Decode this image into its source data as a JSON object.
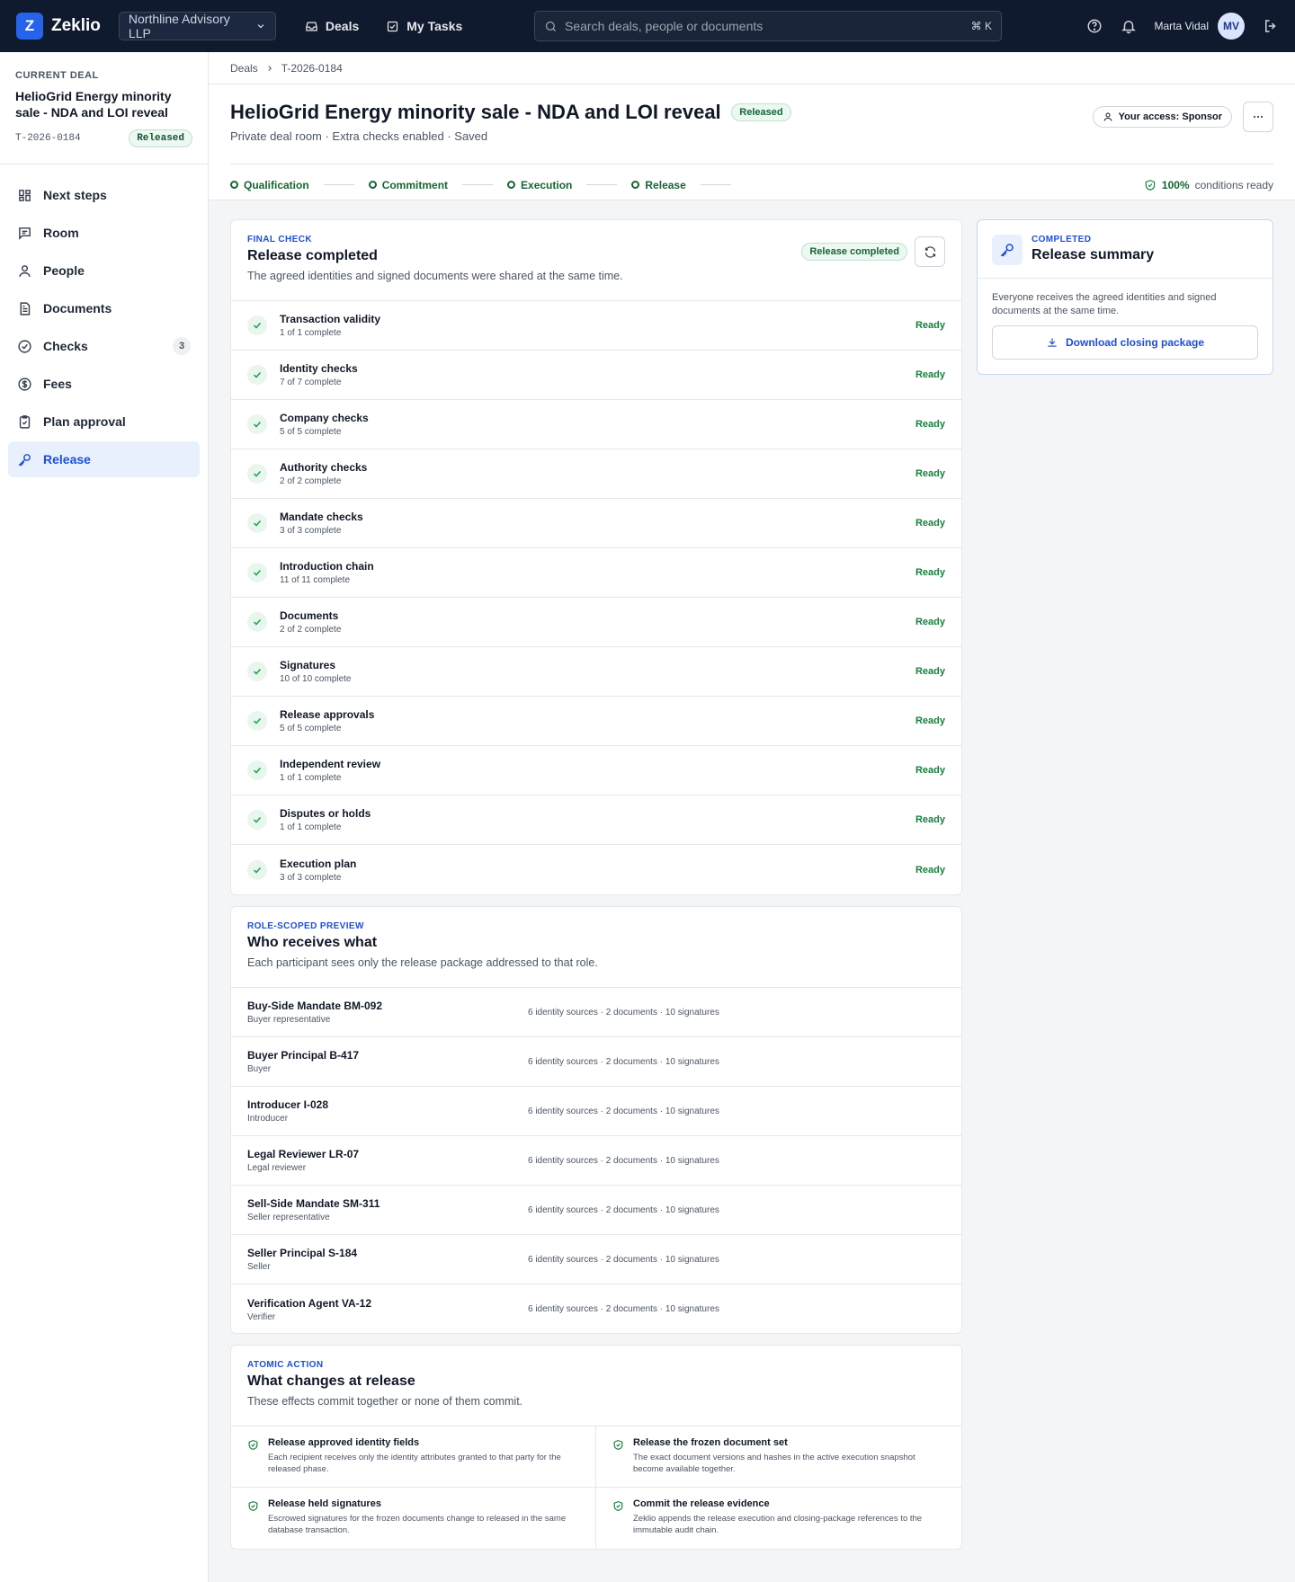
{
  "topbar": {
    "logo_letter": "Z",
    "app_name": "Zeklio",
    "org": "Northline Advisory LLP",
    "nav": [
      {
        "label": "Deals",
        "icon": "inbox-icon"
      },
      {
        "label": "My Tasks",
        "icon": "checkbox-icon"
      }
    ],
    "search_placeholder": "Search deals, people or documents",
    "search_shortcut": "⌘ K",
    "user_name": "Marta Vidal",
    "user_initials": "MV"
  },
  "sidebar": {
    "current_label": "CURRENT DEAL",
    "deal_title": "HelioGrid Energy minority sale - NDA and LOI reveal",
    "deal_id": "T-2026-0184",
    "deal_status": "Released",
    "items": [
      {
        "label": "Next steps",
        "icon": "grid-icon"
      },
      {
        "label": "Room",
        "icon": "message-icon"
      },
      {
        "label": "People",
        "icon": "person-icon"
      },
      {
        "label": "Documents",
        "icon": "document-icon"
      },
      {
        "label": "Checks",
        "icon": "check-circle-icon",
        "count": "3"
      },
      {
        "label": "Fees",
        "icon": "dollar-icon"
      },
      {
        "label": "Plan approval",
        "icon": "clipboard-icon"
      },
      {
        "label": "Release",
        "icon": "key-icon",
        "active": true
      }
    ]
  },
  "header": {
    "breadcrumbs": [
      "Deals",
      "T-2026-0184"
    ],
    "title": "HelioGrid Energy minority sale - NDA and LOI reveal",
    "status": "Released",
    "subtitle": "Private deal room · Extra checks enabled · Saved",
    "access": "Your access: Sponsor",
    "steps": [
      "Qualification",
      "Commitment",
      "Execution",
      "Release"
    ],
    "conditions_pct": "100%",
    "conditions_label": "conditions ready"
  },
  "final_check": {
    "eyebrow": "FINAL CHECK",
    "title": "Release completed",
    "desc": "The agreed identities and signed documents were shared at the same time.",
    "badge": "Release completed",
    "rows": [
      {
        "title": "Transaction validity",
        "sub": "1 of 1 complete",
        "status": "Ready"
      },
      {
        "title": "Identity checks",
        "sub": "7 of 7 complete",
        "status": "Ready"
      },
      {
        "title": "Company checks",
        "sub": "5 of 5 complete",
        "status": "Ready"
      },
      {
        "title": "Authority checks",
        "sub": "2 of 2 complete",
        "status": "Ready"
      },
      {
        "title": "Mandate checks",
        "sub": "3 of 3 complete",
        "status": "Ready"
      },
      {
        "title": "Introduction chain",
        "sub": "11 of 11 complete",
        "status": "Ready"
      },
      {
        "title": "Documents",
        "sub": "2 of 2 complete",
        "status": "Ready"
      },
      {
        "title": "Signatures",
        "sub": "10 of 10 complete",
        "status": "Ready"
      },
      {
        "title": "Release approvals",
        "sub": "5 of 5 complete",
        "status": "Ready"
      },
      {
        "title": "Independent review",
        "sub": "1 of 1 complete",
        "status": "Ready"
      },
      {
        "title": "Disputes or holds",
        "sub": "1 of 1 complete",
        "status": "Ready"
      },
      {
        "title": "Execution plan",
        "sub": "3 of 3 complete",
        "status": "Ready"
      }
    ]
  },
  "recipients": {
    "eyebrow": "ROLE-SCOPED PREVIEW",
    "title": "Who receives what",
    "desc": "Each participant sees only the release package addressed to that role.",
    "rows": [
      {
        "name": "Buy-Side Mandate BM-092",
        "role": "Buyer representative",
        "summary": "6 identity sources · 2 documents · 10 signatures"
      },
      {
        "name": "Buyer Principal B-417",
        "role": "Buyer",
        "summary": "6 identity sources · 2 documents · 10 signatures"
      },
      {
        "name": "Introducer I-028",
        "role": "Introducer",
        "summary": "6 identity sources · 2 documents · 10 signatures"
      },
      {
        "name": "Legal Reviewer LR-07",
        "role": "Legal reviewer",
        "summary": "6 identity sources · 2 documents · 10 signatures"
      },
      {
        "name": "Sell-Side Mandate SM-311",
        "role": "Seller representative",
        "summary": "6 identity sources · 2 documents · 10 signatures"
      },
      {
        "name": "Seller Principal S-184",
        "role": "Seller",
        "summary": "6 identity sources · 2 documents · 10 signatures"
      },
      {
        "name": "Verification Agent VA-12",
        "role": "Verifier",
        "summary": "6 identity sources · 2 documents · 10 signatures"
      }
    ]
  },
  "atomic": {
    "eyebrow": "ATOMIC ACTION",
    "title": "What changes at release",
    "desc": "These effects commit together or none of them commit.",
    "effects": [
      {
        "title": "Release approved identity fields",
        "desc": "Each recipient receives only the identity attributes granted to that party for the released phase."
      },
      {
        "title": "Release the frozen document set",
        "desc": "The exact document versions and hashes in the active execution snapshot become available together."
      },
      {
        "title": "Release held signatures",
        "desc": "Escrowed signatures for the frozen documents change to released in the same database transaction."
      },
      {
        "title": "Commit the release evidence",
        "desc": "Zeklio appends the release execution and closing-package references to the immutable audit chain."
      }
    ]
  },
  "summary": {
    "eyebrow": "COMPLETED",
    "title": "Release summary",
    "desc": "Everyone receives the agreed identities and signed documents at the same time.",
    "button": "Download closing package"
  }
}
